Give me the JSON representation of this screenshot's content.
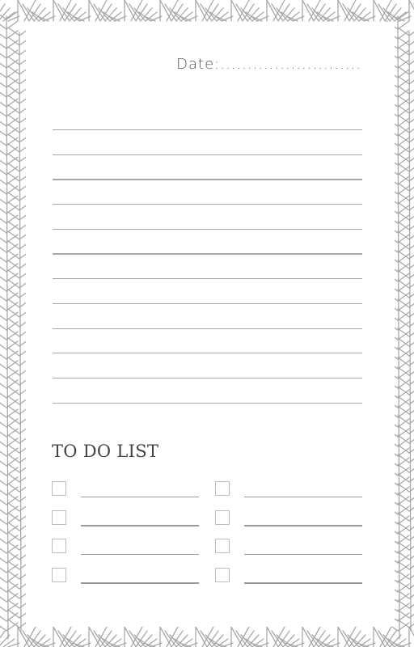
{
  "page": {
    "background_color": "#ffffff",
    "pattern_color": "#a8a8a8"
  },
  "header": {
    "date_label": "Date:.........................."
  },
  "notes": {
    "line_count": 12
  },
  "todo": {
    "title": "TO DO LIST",
    "left_items": [
      "",
      "",
      "",
      ""
    ],
    "right_items": [
      "",
      "",
      "",
      ""
    ]
  }
}
